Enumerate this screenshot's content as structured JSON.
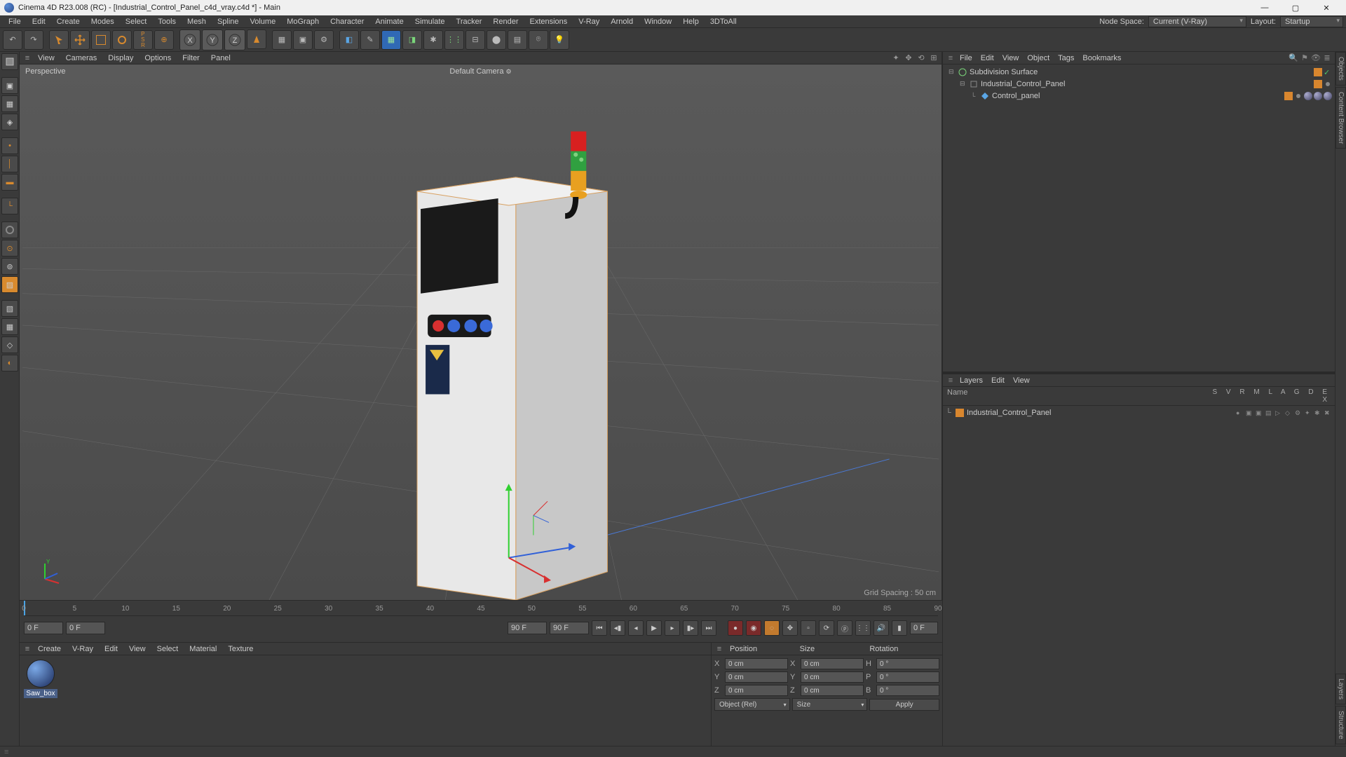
{
  "title": "Cinema 4D R23.008 (RC) - [Industrial_Control_Panel_c4d_vray.c4d *] - Main",
  "menubar": [
    "File",
    "Edit",
    "Create",
    "Modes",
    "Select",
    "Tools",
    "Mesh",
    "Spline",
    "Volume",
    "MoGraph",
    "Character",
    "Animate",
    "Simulate",
    "Tracker",
    "Render",
    "Extensions",
    "V-Ray",
    "Arnold",
    "Window",
    "Help",
    "3DToAll"
  ],
  "node_space_label": "Node Space:",
  "node_space_value": "Current (V-Ray)",
  "layout_label": "Layout:",
  "layout_value": "Startup",
  "viewport_menu": [
    "View",
    "Cameras",
    "Display",
    "Options",
    "Filter",
    "Panel"
  ],
  "viewport": {
    "label": "Perspective",
    "camera": "Default Camera",
    "grid_info": "Grid Spacing : 50 cm"
  },
  "objects_panel": {
    "menu": [
      "File",
      "Edit",
      "View",
      "Object",
      "Tags",
      "Bookmarks"
    ],
    "tree": [
      {
        "indent": 0,
        "icon": "subdiv",
        "name": "Subdivision Surface",
        "tags": [
          "layer",
          "check"
        ]
      },
      {
        "indent": 1,
        "icon": "null",
        "name": "Industrial_Control_Panel",
        "tags": [
          "layer",
          "dot"
        ]
      },
      {
        "indent": 2,
        "icon": "poly",
        "name": "Control_panel",
        "tags": [
          "layer",
          "dot",
          "t1",
          "t2",
          "t3"
        ]
      }
    ]
  },
  "layers_panel": {
    "menu": [
      "Layers",
      "Edit",
      "View"
    ],
    "name_col": "Name",
    "col_heads": "S  V  R  M  L  A  G  D  E  X",
    "layer_name": "Industrial_Control_Panel"
  },
  "timeline": {
    "ticks": [
      "0",
      "5",
      "10",
      "15",
      "20",
      "25",
      "30",
      "35",
      "40",
      "45",
      "50",
      "55",
      "60",
      "65",
      "70",
      "75",
      "80",
      "85",
      "90"
    ],
    "start": "0 F",
    "range_start": "0 F",
    "range_end": "90 F",
    "end": "90 F",
    "pos_end": "0 F"
  },
  "material_menu": [
    "Create",
    "V-Ray",
    "Edit",
    "View",
    "Select",
    "Material",
    "Texture"
  ],
  "material_name": "Saw_box",
  "coord": {
    "position": "Position",
    "size": "Size",
    "rotation": "Rotation",
    "x": "X",
    "y": "Y",
    "z": "Z",
    "h_label": "H",
    "p_label": "P",
    "b_label": "B",
    "px": "0 cm",
    "py": "0 cm",
    "pz": "0 cm",
    "sx": "0 cm",
    "sy": "0 cm",
    "sz": "0 cm",
    "rh": "0 °",
    "rp": "0 °",
    "rb": "0 °",
    "obj_mode": "Object (Rel)",
    "size_mode": "Size",
    "apply": "Apply"
  }
}
